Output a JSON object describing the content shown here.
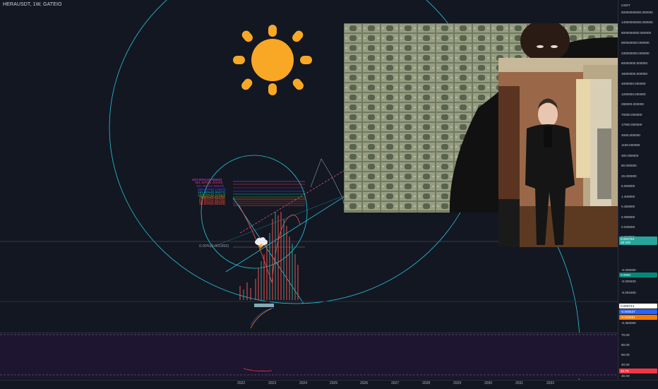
{
  "header": {
    "symbol_title": "HERAUSDT, 1W, GATEIO"
  },
  "price_scale": {
    "unit": "USDT",
    "ticks": [
      "50000000000.000000",
      "14000000000.000000",
      "5000000000.000000",
      "900000000.000000",
      "230000000.000000",
      "60000000.000000",
      "16000000.000000",
      "4000000.000000",
      "1200000.000000",
      "280000.000000",
      "70000.000000",
      "17500.000000",
      "4500.000000",
      "1100.000000",
      "300.000000",
      "80.000000",
      "20.000000",
      "5.000000",
      "1.400000",
      "0.350000",
      "0.090000",
      "0.025000",
      "0.007000"
    ],
    "lower_ticks": [
      "-0.000000",
      "-0.000400",
      "-0.001600",
      "-0.350000"
    ],
    "current_price": {
      "value": "0.004794",
      "sub": "3d 22h"
    },
    "secondary_badge": "0.0094",
    "indicator_badges": [
      {
        "value": "0.006744",
        "color": "#ffffff",
        "text_color": "#131722"
      },
      {
        "value": "-0.000537",
        "color": "#2962ff",
        "text_color": "#ffffff"
      },
      {
        "value": "-0.029081",
        "color": "#f57c00",
        "text_color": "#ffffff"
      }
    ],
    "rsi_ticks": [
      "70.00",
      "60.00",
      "50.00",
      "40.00",
      "30.00"
    ],
    "rsi_badge": "34.76"
  },
  "time_scale": {
    "years": [
      "2022",
      "2023",
      "2024",
      "2025",
      "2026",
      "2027",
      "2028",
      "2029",
      "2030",
      "2031",
      "2032"
    ]
  },
  "fib_levels": [
    {
      "label": "423.60%(16.45563)",
      "color": "#e040fb"
    },
    {
      "label": "361.80%(5.40040)",
      "color": "#f23645"
    },
    {
      "label": "261.80%(1.06540)",
      "color": "#9c27b0"
    },
    {
      "label": "200.00%(0.13402)",
      "color": "#2962ff"
    },
    {
      "label": "161.80%(0.05371)",
      "color": "#00bcd4"
    },
    {
      "label": "100.00%(0.01563)",
      "color": "#4caf50"
    },
    {
      "label": "78.60%(0.01176)",
      "color": "#ff9800"
    },
    {
      "label": "61.80%(0.00780)",
      "color": "#f23645"
    },
    {
      "label": "50.00%(0.00538)",
      "color": "#f44336"
    },
    {
      "label": "38.20%(0.00423)",
      "color": "#ef5350"
    }
  ],
  "fib_zero": {
    "label": "0.00%(0.001892)"
  },
  "overlays": {
    "sun_icon": "sun-icon",
    "cloud_icon": "cloud-lightning-icon",
    "photo_money": "money-stacks-photo",
    "photo_man": "man-in-suit-photo"
  },
  "colors": {
    "background": "#131722",
    "circle": "#26c6da",
    "rsi_pane": "#1e1530",
    "sun": "#f9a825",
    "price_badge": "#26a69a"
  }
}
